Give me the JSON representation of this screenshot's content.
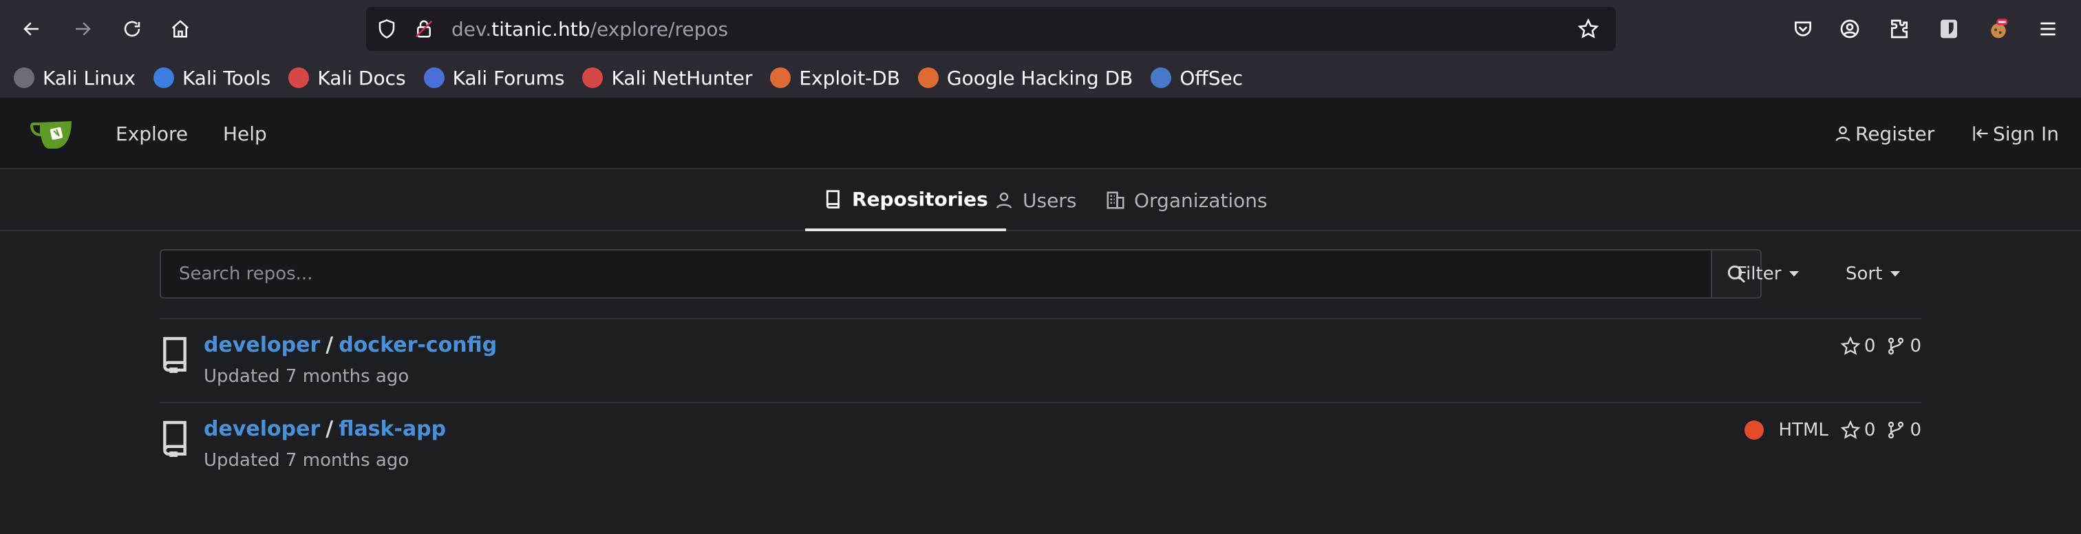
{
  "browser": {
    "url_prefix": "dev.",
    "url_host": "titanic.htb",
    "url_path": "/explore/repos"
  },
  "bookmarks": [
    {
      "label": "Kali Linux",
      "color": "#9aa0a6"
    },
    {
      "label": "Kali Tools",
      "color": "#3b7de0"
    },
    {
      "label": "Kali Docs",
      "color": "#d64848"
    },
    {
      "label": "Kali Forums",
      "color": "#4a6fd9"
    },
    {
      "label": "Kali NetHunter",
      "color": "#d64848"
    },
    {
      "label": "Exploit-DB",
      "color": "#e06a33"
    },
    {
      "label": "Google Hacking DB",
      "color": "#e06a33"
    },
    {
      "label": "OffSec",
      "color": "#4a78c9"
    }
  ],
  "header": {
    "explore": "Explore",
    "help": "Help",
    "register": "Register",
    "sign_in": "Sign In"
  },
  "tabs": {
    "repositories": "Repositories",
    "users": "Users",
    "organizations": "Organizations"
  },
  "search": {
    "placeholder": "Search repos...",
    "filter": "Filter",
    "sort": "Sort"
  },
  "repos": [
    {
      "owner": "developer",
      "name": "docker-config",
      "updated": "Updated 7 months ago",
      "language": "",
      "stars": "0",
      "forks": "0"
    },
    {
      "owner": "developer",
      "name": "flask-app",
      "updated": "Updated 7 months ago",
      "language": "HTML",
      "language_color": "#e34c26",
      "stars": "0",
      "forks": "0"
    }
  ]
}
